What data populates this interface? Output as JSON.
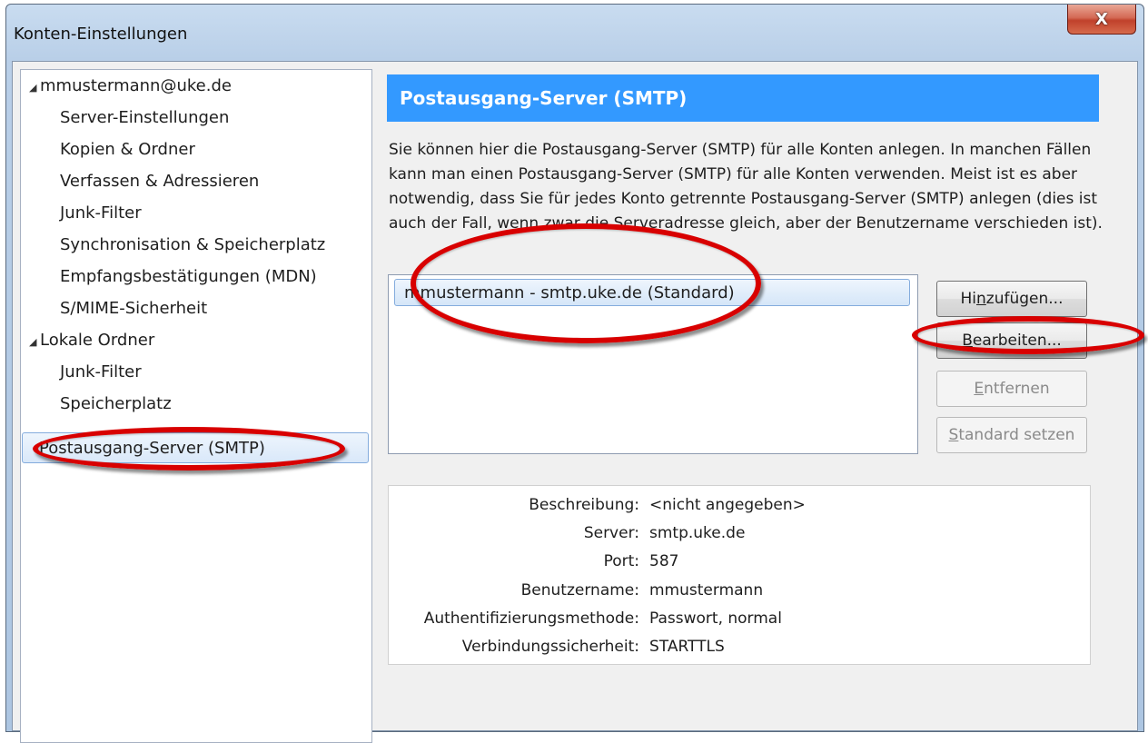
{
  "window": {
    "title": "Konten-Einstellungen",
    "close_label": "X"
  },
  "tree": {
    "items": [
      {
        "label": "mmustermann@uke.de",
        "expanded": true
      },
      {
        "label": "Server-Einstellungen"
      },
      {
        "label": "Kopien & Ordner"
      },
      {
        "label": "Verfassen & Adressieren"
      },
      {
        "label": "Junk-Filter"
      },
      {
        "label": "Synchronisation & Speicherplatz"
      },
      {
        "label": "Empfangsbestätigungen (MDN)"
      },
      {
        "label": "S/MIME-Sicherheit"
      },
      {
        "label": "Lokale Ordner",
        "expanded": true
      },
      {
        "label": "Junk-Filter"
      },
      {
        "label": "Speicherplatz"
      },
      {
        "label": "Postausgang-Server (SMTP)",
        "selected": true
      }
    ]
  },
  "panel": {
    "header": "Postausgang-Server (SMTP)",
    "description": "Sie können hier die Postausgang-Server (SMTP) für alle Konten anlegen. In manchen Fällen kann man einen Postausgang-Server (SMTP) für alle Konten verwenden. Meist ist es aber notwendig, dass Sie für jedes Konto getrennte Postausgang-Server (SMTP) anlegen (dies ist auch der Fall, wenn zwar die Serveradresse gleich, aber der Benutzername verschieden ist).",
    "server_list": [
      "mmustermann - smtp.uke.de (Standard)"
    ],
    "buttons": {
      "add_pre": "Hi",
      "add_key": "n",
      "add_post": "zufügen...",
      "edit_key": "B",
      "edit_post": "earbeiten...",
      "remove_key": "E",
      "remove_post": "ntfernen",
      "default_key": "S",
      "default_post": "tandard setzen"
    },
    "details": {
      "description_label": "Beschreibung:",
      "description_value": "<nicht angegeben>",
      "server_label": "Server:",
      "server_value": "smtp.uke.de",
      "port_label": "Port:",
      "port_value": "587",
      "username_label": "Benutzername:",
      "username_value": "mmustermann",
      "auth_label": "Authentifizierungsmethode:",
      "auth_value": "Passwort, normal",
      "security_label": "Verbindungssicherheit:",
      "security_value": "STARTTLS"
    }
  },
  "colors": {
    "header_blue": "#3399ff",
    "annotation_red": "#d80000"
  }
}
